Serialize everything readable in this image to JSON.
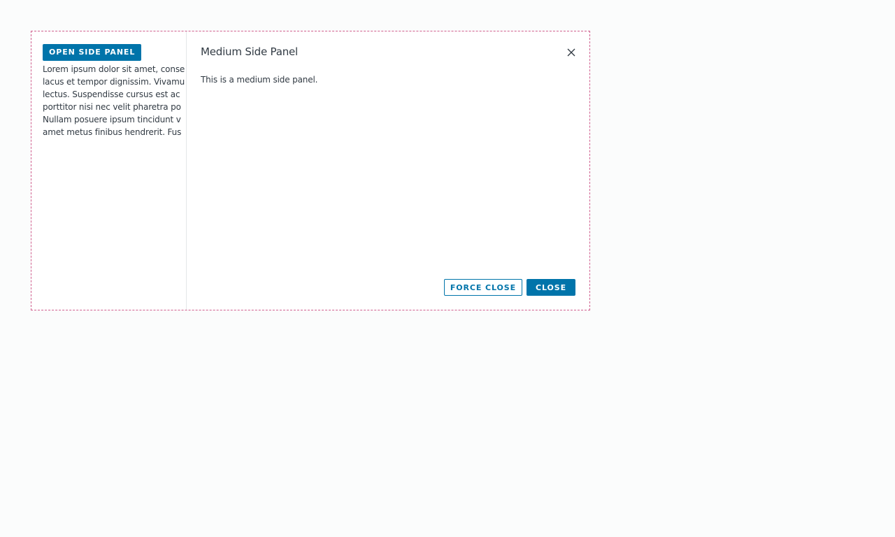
{
  "page": {
    "open_button_label": "OPEN SIDE PANEL",
    "lorem_text": "Lorem ipsum dolor sit amet, consectetur adipiscing elit. Integer nec odio. Praesent libero. Sed cursus ante dapibus diam. Sed nisi. Nulla quis sem at nibh elementum imperdiet. Duis sagittis ipsum. Praesent mauris. Fusce nec tellus sed augue semper porta. Mauris massa. Vestibulum lacinia arcu eget nulla. Class aptent taciti sociosqu ad litora torquent per conubia nostra, per inceptos himenaeos. Curabitur sodales ligula in libero. Sed dignissim lacinia nunc. Curabitur tortor. Pellentesque nibh. Aenean quam. In scelerisque sem at dolor. Maecenas mattis. Sed convallis tristique sem. Proin ut ligula vel nunc egestas porttitor. Morbi lectus risus, iaculis vel, suscipit quis, luctus non, massa. Fusce ac turpis quis ligula lacinia aliquet. Mauris ipsum. Nulla metus metus, ullamcorper vel, tincidunt sed, euismod in, nibh.",
    "lorem_lines": [
      "Lorem ipsum dolor sit amet, conse",
      "lacus et tempor dignissim. Vivamu",
      "lectus. Suspendisse cursus est ac",
      "porttitor nisi nec velit pharetra po",
      "Nullam posuere ipsum tincidunt v",
      "amet metus finibus hendrerit. Fus"
    ]
  },
  "side_panel": {
    "title": "Medium Side Panel",
    "body": "This is a medium side panel.",
    "close_icon": "close-icon",
    "force_close_label": "FORCE CLOSE",
    "close_label": "CLOSE"
  },
  "colors": {
    "primary": "#0074aa",
    "frame_border": "#d05f8e",
    "text": "#313a43",
    "background": "#fbfcfc"
  }
}
